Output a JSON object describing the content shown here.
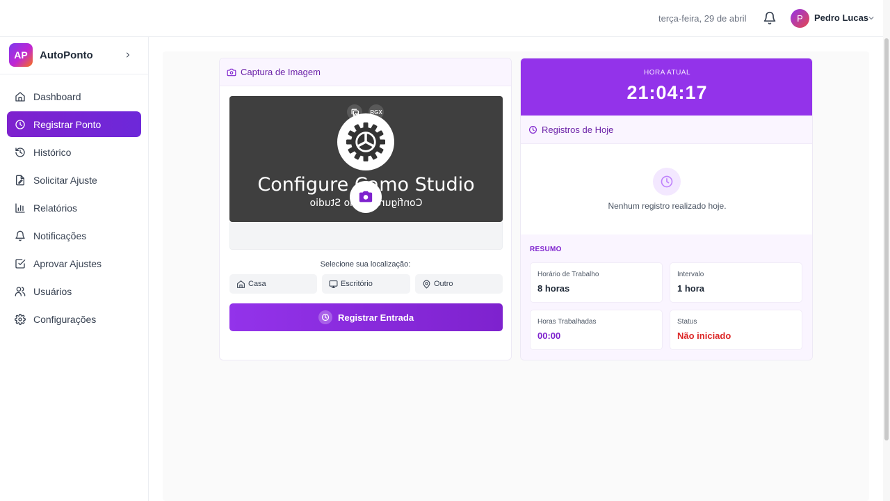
{
  "header": {
    "date": "terça-feira, 29 de abril",
    "user_initial": "P",
    "user_name": "Pedro Lucas"
  },
  "sidebar": {
    "logo_text": "AP",
    "app_name": "AutoPonto",
    "items": [
      {
        "label": "Dashboard",
        "icon": "home-icon",
        "active": false
      },
      {
        "label": "Registrar Ponto",
        "icon": "clock-icon",
        "active": true
      },
      {
        "label": "Histórico",
        "icon": "history-icon",
        "active": false
      },
      {
        "label": "Solicitar Ajuste",
        "icon": "file-edit-icon",
        "active": false
      },
      {
        "label": "Relatórios",
        "icon": "bar-chart-icon",
        "active": false
      },
      {
        "label": "Notificações",
        "icon": "bell-icon",
        "active": false
      },
      {
        "label": "Aprovar Ajustes",
        "icon": "check-square-icon",
        "active": false
      },
      {
        "label": "Usuários",
        "icon": "users-icon",
        "active": false
      },
      {
        "label": "Configurações",
        "icon": "settings-icon",
        "active": false
      }
    ]
  },
  "capture": {
    "title": "Captura de Imagem",
    "preview_text": "Configure Camo Studio",
    "preview_mirror_text": "Configure Camo Studio",
    "rgx_label": "RGX",
    "location_prompt": "Selecione sua localização:",
    "locations": [
      {
        "label": "Casa",
        "icon": "home-icon"
      },
      {
        "label": "Escritório",
        "icon": "monitor-icon"
      },
      {
        "label": "Outro",
        "icon": "map-pin-icon"
      }
    ],
    "submit_label": "Registrar Entrada"
  },
  "clock": {
    "label": "HORA ATUAL",
    "time": "21:04:17"
  },
  "today": {
    "title": "Registros de Hoje",
    "empty_text": "Nenhum registro realizado hoje."
  },
  "summary": {
    "title": "RESUMO",
    "stats": [
      {
        "label": "Horário de Trabalho",
        "value": "8 horas"
      },
      {
        "label": "Intervalo",
        "value": "1 hora"
      },
      {
        "label": "Horas Trabalhadas",
        "value": "00:00"
      },
      {
        "label": "Status",
        "value": "Não iniciado"
      }
    ]
  },
  "colors": {
    "accent": "#9333ea",
    "accent_dark": "#7e22ce",
    "status_red": "#dc2626"
  }
}
